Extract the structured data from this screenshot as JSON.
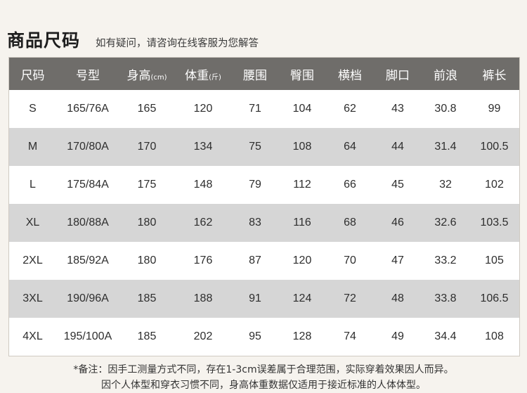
{
  "header": {
    "title": "商品尺码",
    "subtitle": "如有疑问，请咨询在线客服为您解答"
  },
  "table": {
    "columns": [
      {
        "label": "尺码",
        "unit": ""
      },
      {
        "label": "号型",
        "unit": ""
      },
      {
        "label": "身高",
        "unit": "(cm)"
      },
      {
        "label": "体重",
        "unit": "(斤)"
      },
      {
        "label": "腰围",
        "unit": ""
      },
      {
        "label": "臀围",
        "unit": ""
      },
      {
        "label": "横档",
        "unit": ""
      },
      {
        "label": "脚口",
        "unit": ""
      },
      {
        "label": "前浪",
        "unit": ""
      },
      {
        "label": "裤长",
        "unit": ""
      }
    ],
    "rows": [
      [
        "S",
        "165/76A",
        "165",
        "120",
        "71",
        "104",
        "62",
        "43",
        "30.8",
        "99"
      ],
      [
        "M",
        "170/80A",
        "170",
        "134",
        "75",
        "108",
        "64",
        "44",
        "31.4",
        "100.5"
      ],
      [
        "L",
        "175/84A",
        "175",
        "148",
        "79",
        "112",
        "66",
        "45",
        "32",
        "102"
      ],
      [
        "XL",
        "180/88A",
        "180",
        "162",
        "83",
        "116",
        "68",
        "46",
        "32.6",
        "103.5"
      ],
      [
        "2XL",
        "185/92A",
        "180",
        "176",
        "87",
        "120",
        "70",
        "47",
        "33.2",
        "105"
      ],
      [
        "3XL",
        "190/96A",
        "185",
        "188",
        "91",
        "124",
        "72",
        "48",
        "33.8",
        "106.5"
      ],
      [
        "4XL",
        "195/100A",
        "185",
        "202",
        "95",
        "128",
        "74",
        "49",
        "34.4",
        "108"
      ]
    ]
  },
  "notes": {
    "line1": "*备注：因手工测量方式不同，存在1-3cm误差属于合理范围，实际穿着效果因人而异。",
    "line2": "因个人体型和穿衣习惯不同，身高体重数据仅适用于接近标准的人体体型。"
  }
}
